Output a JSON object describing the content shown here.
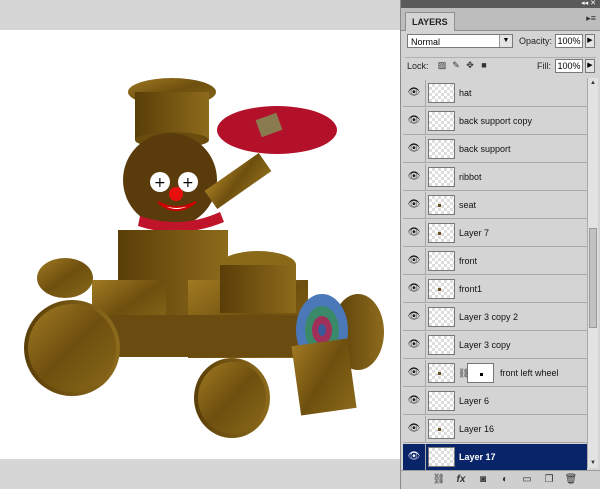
{
  "panel": {
    "title": "LAYERS",
    "top_controls": "◂◂ ✕",
    "menu_icon": "▸≡",
    "blend_mode": "Normal",
    "opacity_label": "Opacity:",
    "opacity_value": "100%",
    "lock_label": "Lock:",
    "fill_label": "Fill:",
    "fill_value": "100%"
  },
  "layers": [
    {
      "name": "hat",
      "selected": false
    },
    {
      "name": "back support copy",
      "selected": false
    },
    {
      "name": "back support",
      "selected": false
    },
    {
      "name": "ribbot",
      "selected": false
    },
    {
      "name": "seat",
      "selected": false
    },
    {
      "name": "Layer 7",
      "selected": false
    },
    {
      "name": "front",
      "selected": false
    },
    {
      "name": "front1",
      "selected": false
    },
    {
      "name": "Layer 3 copy 2",
      "selected": false
    },
    {
      "name": "Layer 3 copy",
      "selected": false
    },
    {
      "name": "front left wheel",
      "selected": false,
      "mask": true
    },
    {
      "name": "Layer 6",
      "selected": false
    },
    {
      "name": "Layer 16",
      "selected": false
    },
    {
      "name": "Layer 17",
      "selected": true
    }
  ],
  "bottom_icons": [
    "link-icon",
    "fx-icon",
    "mask-icon",
    "adjustment-icon",
    "group-icon",
    "new-layer-icon",
    "trash-icon"
  ],
  "colors": {
    "selection": "#0a246a",
    "wood": "#7a5a12",
    "ribbon": "#c0142a"
  }
}
